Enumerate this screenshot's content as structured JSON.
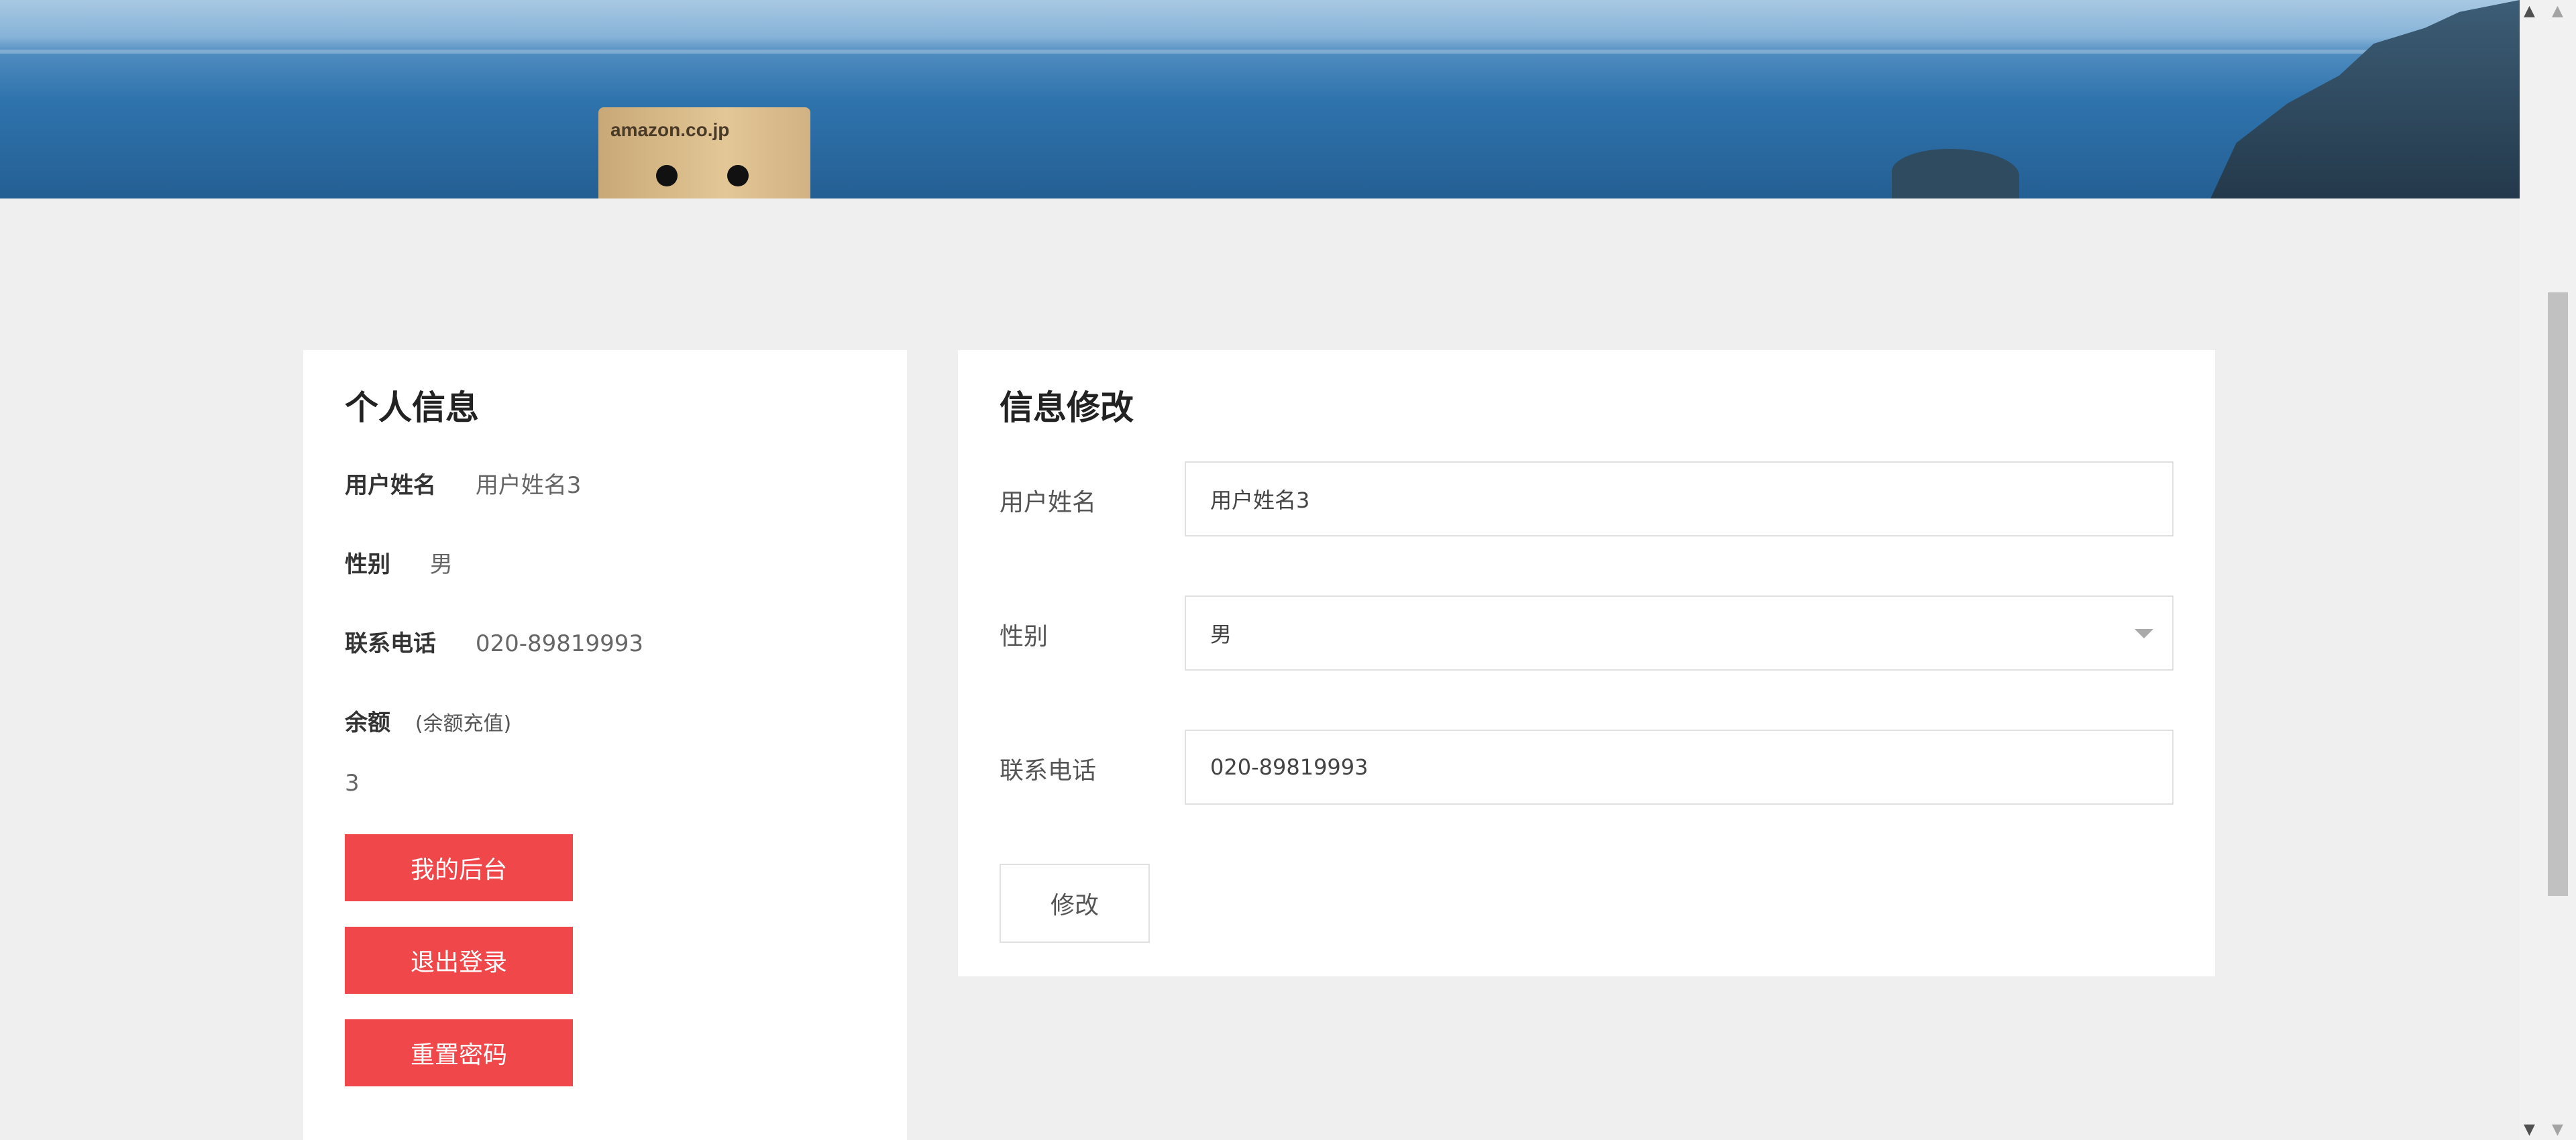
{
  "hero": {
    "box_brand": "amazon.co.jp"
  },
  "profile": {
    "title": "个人信息",
    "name_label": "用户姓名",
    "name_value": "用户姓名3",
    "gender_label": "性别",
    "gender_value": "男",
    "phone_label": "联系电话",
    "phone_value": "020-89819993",
    "balance_label": "余额",
    "recharge_link": "(余额充值)",
    "balance_value": "3",
    "buttons": {
      "dashboard": "我的后台",
      "logout": "退出登录",
      "reset_password": "重置密码"
    }
  },
  "edit_form": {
    "title": "信息修改",
    "name_label": "用户姓名",
    "name_value": "用户姓名3",
    "gender_label": "性别",
    "gender_value": "男",
    "phone_label": "联系电话",
    "phone_value": "020-89819993",
    "submit_label": "修改"
  },
  "colors": {
    "primary_button": "#f0474b",
    "page_background": "#efefef"
  }
}
